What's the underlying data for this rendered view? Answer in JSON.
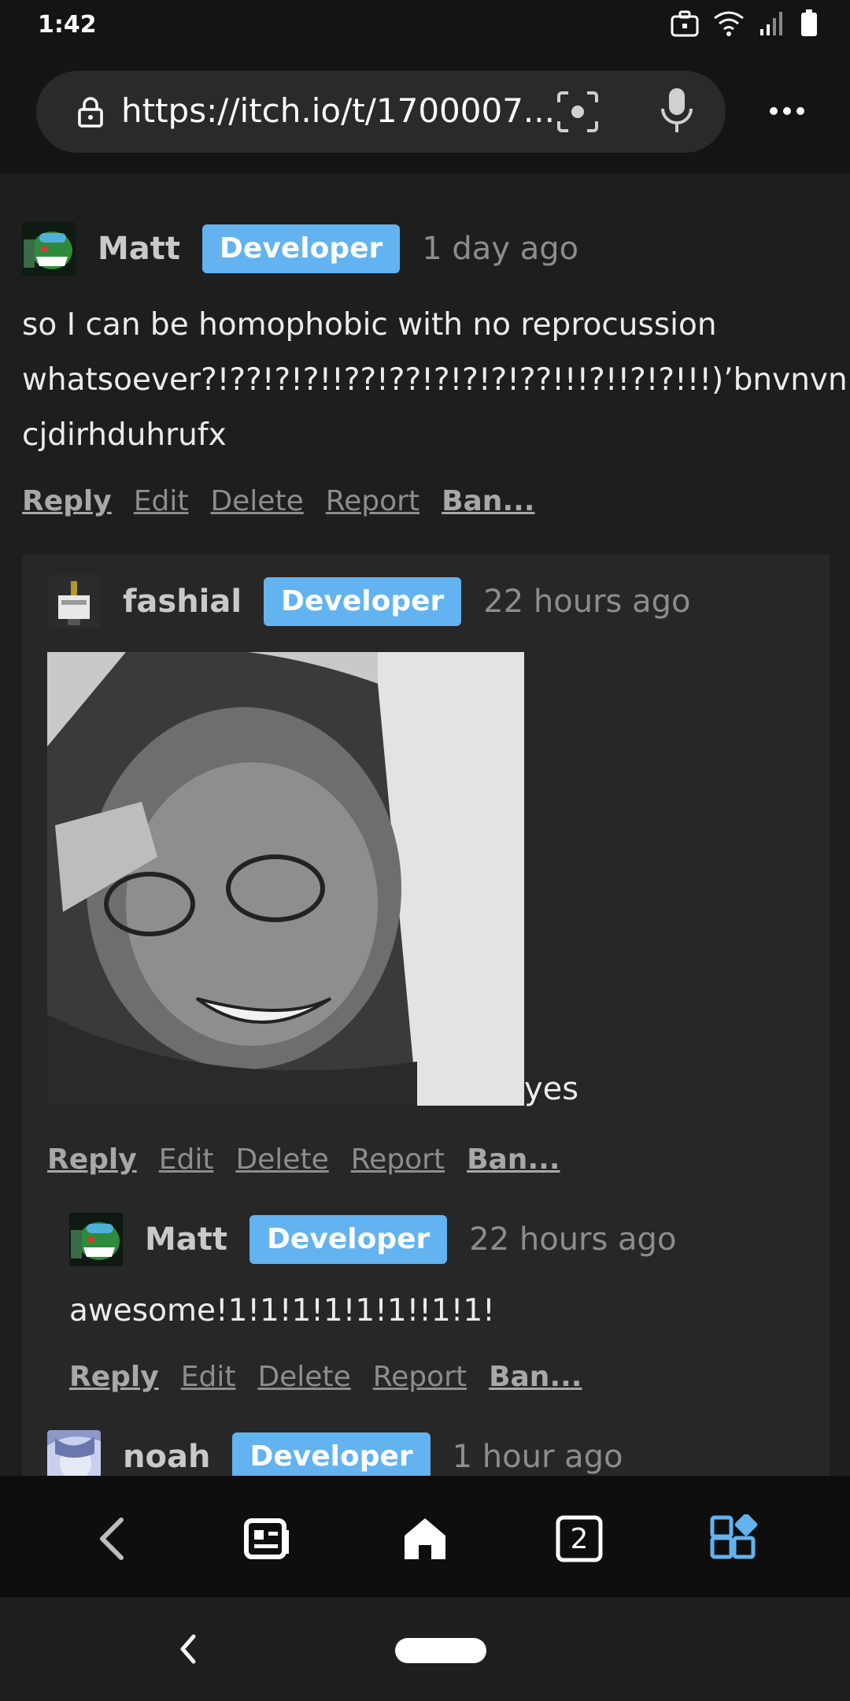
{
  "status_bar": {
    "time": "1:42",
    "icons": [
      "briefcase-icon",
      "wifi-icon",
      "signal-icon",
      "battery-icon"
    ]
  },
  "browser": {
    "url": "https://itch.io/t/1700007...",
    "icons": [
      "lock-icon",
      "scan-icon",
      "mic-icon",
      "more-menu-icon"
    ]
  },
  "colors": {
    "background": "#1e1e1e",
    "nested_background": "#272727",
    "badge": "#62b3f0",
    "text": "#ececec",
    "muted": "#8d8d8d"
  },
  "comments": [
    {
      "username": "Matt",
      "badge": "Developer",
      "time": "1 day ago",
      "body_lines": [
        "so I can be homophobic with no reprocussion",
        "whatsoever?!??!?!?!!??!??!?!?!?!??!!!?!!?!?!!!)’bnvnvnncn",
        "cjdirhduhrufx"
      ],
      "actions": [
        "Reply",
        "Edit",
        "Delete",
        "Report",
        "Ban..."
      ]
    },
    {
      "username": "fashial",
      "badge": "Developer",
      "time": "22 hours ago",
      "body": "yes",
      "actions": [
        "Reply",
        "Edit",
        "Delete",
        "Report",
        "Ban..."
      ]
    },
    {
      "username": "Matt",
      "badge": "Developer",
      "time": "22 hours ago",
      "body": "awesome!1!1!1!1!1!1!!1!1!",
      "actions": [
        "Reply",
        "Edit",
        "Delete",
        "Report",
        "Ban..."
      ]
    },
    {
      "username": "noah",
      "badge": "Developer",
      "time": "1 hour ago"
    }
  ],
  "bottom_nav": {
    "items": [
      "back-icon",
      "feed-icon",
      "home-icon",
      "tabs-icon",
      "extensions-icon"
    ],
    "tab_count": "2"
  }
}
